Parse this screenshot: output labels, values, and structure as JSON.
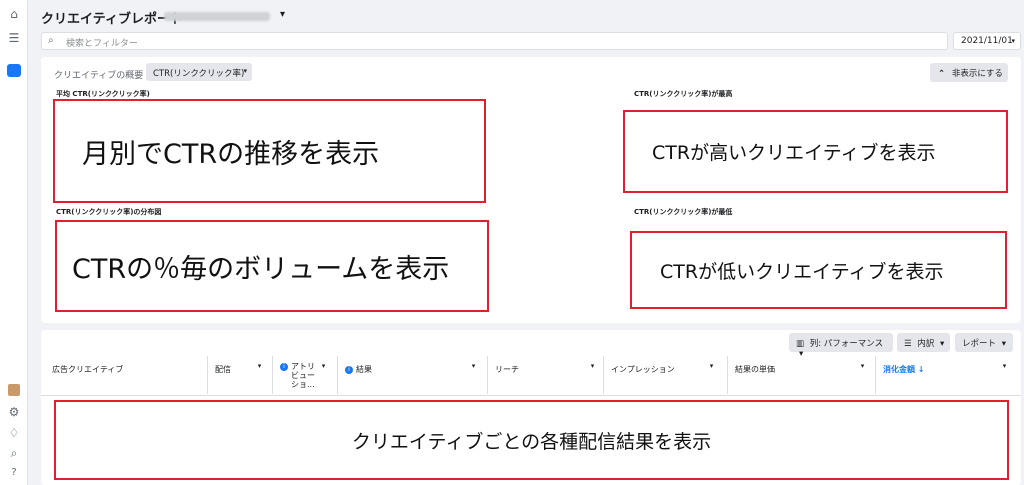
{
  "rail": {
    "icons": [
      "home-icon",
      "menu-icon",
      "creative-report-icon",
      "ad-account-icon",
      "settings-icon",
      "bell-icon",
      "search-icon",
      "help-icon"
    ]
  },
  "header": {
    "title": "クリエイティブレポート",
    "caret": "▾"
  },
  "search": {
    "placeholder": "検索とフィルター",
    "icon": "⌕"
  },
  "date_filter": {
    "value": "2021/11/01",
    "caret": "▾"
  },
  "overview": {
    "label": "クリエイティブの概要",
    "metric": "CTR(リンククリック率)",
    "hide_label": "非表示にする",
    "hide_icon": "⌃"
  },
  "sections": {
    "avg_ctr": "平均 CTR(リンククリック率)",
    "top_ctr": "CTR(リンククリック率)が最高",
    "distribution": "CTR(リンククリック率)の分布図",
    "low_ctr": "CTR(リンククリック率)が最低"
  },
  "annotations": {
    "monthly": "月別でCTRの推移を表示",
    "high": "CTRが高いクリエイティブを表示",
    "volume": "CTRの％毎のボリュームを表示",
    "low": "CTRが低いクリエイティブを表示",
    "results": "クリエイティブごとの各種配信結果を表示"
  },
  "toolbar": {
    "columns": "列: パフォーマンス",
    "breakdown": "内訳",
    "report": "レポート",
    "caret": "▾"
  },
  "table": {
    "columns": [
      "広告クリエイティブ",
      "配信",
      "アトリビューショ...",
      "結果",
      "リーチ",
      "インプレッション",
      "結果の単価",
      "消化金額 ↓"
    ],
    "attribution_lines": [
      "アトリ",
      "ビュー",
      "ショ..."
    ]
  },
  "colors": {
    "accent": "#1877f2",
    "annotation_border": "#e0202c"
  }
}
